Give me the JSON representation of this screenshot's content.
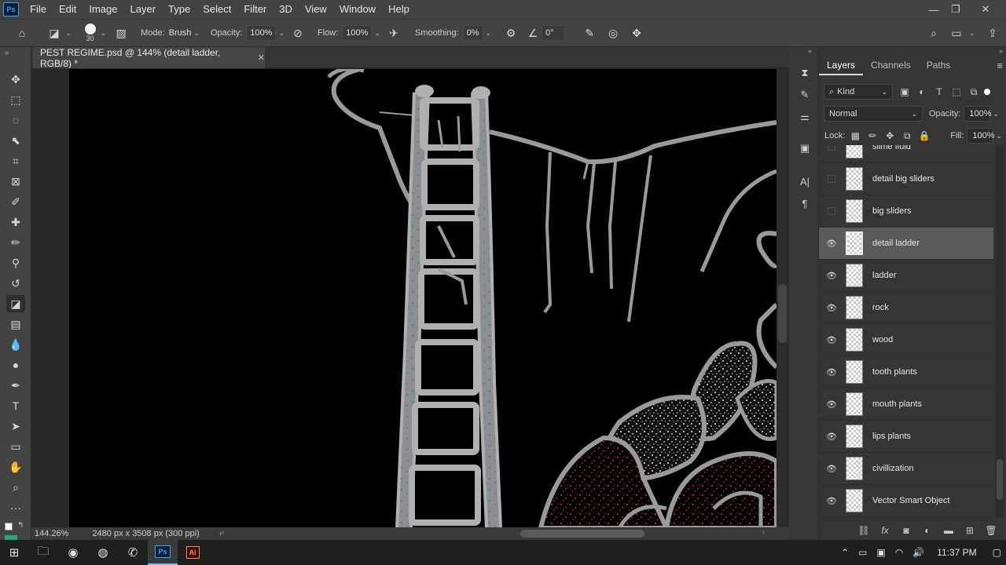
{
  "menubar": {
    "app_badge": "Ps",
    "items": [
      "File",
      "Edit",
      "Image",
      "Layer",
      "Type",
      "Select",
      "Filter",
      "3D",
      "View",
      "Window",
      "Help"
    ]
  },
  "options": {
    "brush_size": "30",
    "mode_label": "Mode:",
    "mode_value": "Brush",
    "opacity_label": "Opacity:",
    "opacity_value": "100%",
    "flow_label": "Flow:",
    "flow_value": "100%",
    "smoothing_label": "Smoothing:",
    "smoothing_value": "0%",
    "angle_value": "0°"
  },
  "document": {
    "tab_title": "PEST REGIME.psd @ 144% (detail ladder, RGB/8) *",
    "zoom": "144.26%",
    "doc_info": "2480 px x 3508 px (300 ppi)"
  },
  "panel": {
    "tabs": [
      "Layers",
      "Channels",
      "Paths"
    ],
    "filter_kind": "Kind",
    "blend_mode": "Normal",
    "opacity_label": "Opacity:",
    "opacity_value": "100%",
    "lock_label": "Lock:",
    "fill_label": "Fill:",
    "fill_value": "100%"
  },
  "layers": [
    {
      "name": "slime fluid",
      "visible": false
    },
    {
      "name": "detail big sliders",
      "visible": false
    },
    {
      "name": "big sliders",
      "visible": false
    },
    {
      "name": "detail ladder",
      "visible": true,
      "selected": true
    },
    {
      "name": "ladder",
      "visible": true
    },
    {
      "name": "rock",
      "visible": true
    },
    {
      "name": "wood",
      "visible": true
    },
    {
      "name": "tooth plants",
      "visible": true
    },
    {
      "name": "mouth plants",
      "visible": true
    },
    {
      "name": "lips plants",
      "visible": true
    },
    {
      "name": "civillization",
      "visible": true
    },
    {
      "name": "Vector Smart Object",
      "visible": true
    }
  ],
  "taskbar": {
    "clock": "11:37 PM"
  },
  "colors": {
    "accent": "#31a8ff",
    "canvas": "#000000",
    "ladder_gray": "#9a9a9a",
    "teal_noise": "#3f8f8f",
    "red_noise": "#c8283c",
    "cream_noise": "#efefd0"
  }
}
